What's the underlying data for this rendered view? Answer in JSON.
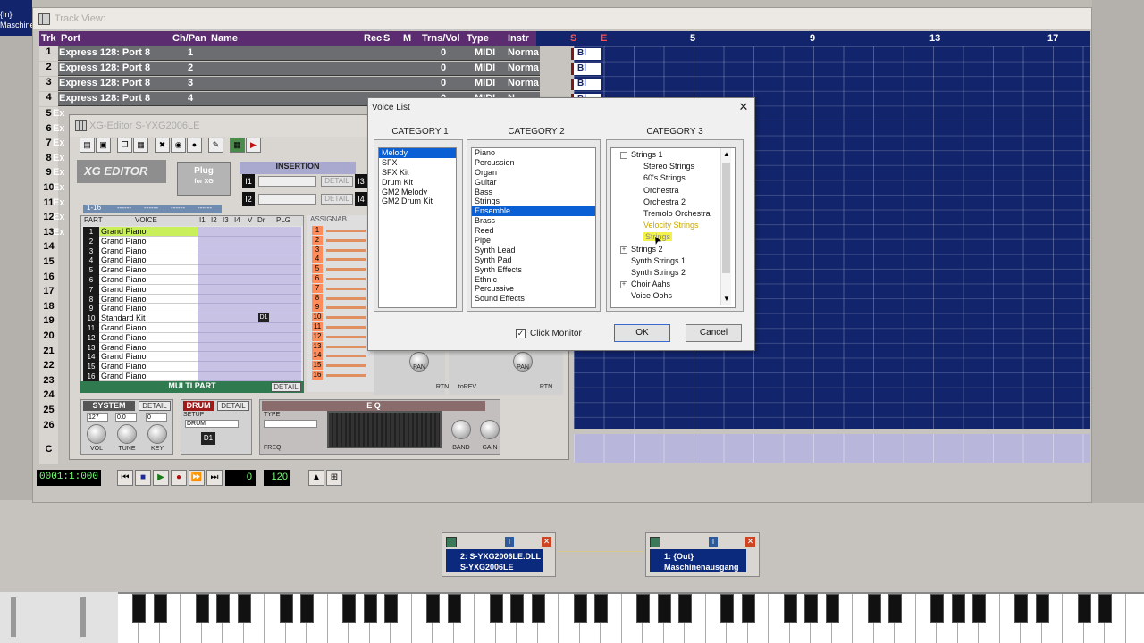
{
  "top_left": {
    "line1": "{In}",
    "line2": "Maschine"
  },
  "track_view": {
    "title": "Track View:",
    "columns": [
      "Trk",
      "Port",
      "Ch/Pan",
      "Name",
      "Rec",
      "S",
      "M",
      "Trns/Vol",
      "Type",
      "Instr"
    ],
    "rows": [
      {
        "trk": "1",
        "port": "Express  128: Port 8",
        "ch": "1",
        "trns": "0",
        "type": "MIDI",
        "instr": "Norma"
      },
      {
        "trk": "2",
        "port": "Express  128: Port 8",
        "ch": "2",
        "trns": "0",
        "type": "MIDI",
        "instr": "Norma"
      },
      {
        "trk": "3",
        "port": "Express  128: Port 8",
        "ch": "3",
        "trns": "0",
        "type": "MIDI",
        "instr": "Norma"
      },
      {
        "trk": "4",
        "port": "Express  128: Port 8",
        "ch": "4",
        "trns": "0",
        "type": "MIDI",
        "instr": "N"
      }
    ],
    "row_numbers": [
      "5",
      "6",
      "7",
      "8",
      "9",
      "10",
      "11",
      "12",
      "13",
      "14",
      "15",
      "16",
      "17",
      "18",
      "19",
      "20",
      "21",
      "22",
      "23",
      "24",
      "25",
      "26"
    ],
    "cut_prefix": "Ex",
    "ruler": {
      "markers": [
        "S",
        "E"
      ],
      "bars": [
        "5",
        "9",
        "13",
        "17"
      ]
    },
    "clips": [
      "Bl",
      "Bl",
      "Bl",
      "Bl"
    ],
    "c_row": "C"
  },
  "transport": {
    "time": "0001:1:000",
    "value": "0",
    "tempo": "120"
  },
  "xg_editor": {
    "title": "XG-Editor  S-YXG2006LE",
    "logo": "XG EDITOR",
    "plug": "Plug",
    "plug_sub": "for XG",
    "insertion_label": "INSERTION",
    "insertion_rows": [
      "I1",
      "I2"
    ],
    "insertion_right": [
      "I3",
      "I4"
    ],
    "detail": "DETAIL",
    "part_tabs": [
      "1-16",
      "------",
      "------",
      "------",
      "------"
    ],
    "multipart_headers": [
      "PART",
      "VOICE",
      "I1",
      "I2",
      "I3",
      "I4",
      "V",
      "Dr",
      "PLG"
    ],
    "assign_header": "ASSIGNAB",
    "parts": [
      {
        "n": "1",
        "voice": "Grand Piano"
      },
      {
        "n": "2",
        "voice": "Grand Piano"
      },
      {
        "n": "3",
        "voice": "Grand Piano"
      },
      {
        "n": "4",
        "voice": "Grand Piano"
      },
      {
        "n": "5",
        "voice": "Grand Piano"
      },
      {
        "n": "6",
        "voice": "Grand Piano"
      },
      {
        "n": "7",
        "voice": "Grand Piano"
      },
      {
        "n": "8",
        "voice": "Grand Piano"
      },
      {
        "n": "9",
        "voice": "Grand Piano"
      },
      {
        "n": "10",
        "voice": "Standard Kit"
      },
      {
        "n": "11",
        "voice": "Grand Piano"
      },
      {
        "n": "12",
        "voice": "Grand Piano"
      },
      {
        "n": "13",
        "voice": "Grand Piano"
      },
      {
        "n": "14",
        "voice": "Grand Piano"
      },
      {
        "n": "15",
        "voice": "Grand Piano"
      },
      {
        "n": "16",
        "voice": "Grand Piano"
      }
    ],
    "drum_marker": "D1",
    "multipart_label": "MULTI PART",
    "system": {
      "label": "SYSTEM",
      "vol": "127",
      "tune": "0.0",
      "key": "0",
      "vol_lbl": "VOL",
      "tune_lbl": "TUNE",
      "key_lbl": "KEY"
    },
    "drum": {
      "label": "DRUM",
      "setup": "SETUP",
      "value": "DRUM",
      "badge": "D1"
    },
    "eq": {
      "label": "E Q",
      "type": "TYPE",
      "freq": "FREQ",
      "band": "BAND",
      "gain": "GAIN"
    },
    "knob_labels": [
      "PAN",
      "RTN",
      "toREV",
      "PAN",
      "RTN"
    ]
  },
  "voice_list": {
    "title": "Voice List",
    "close": "✕",
    "cat1_label": "CATEGORY 1",
    "cat2_label": "CATEGORY 2",
    "cat3_label": "CATEGORY 3",
    "cat1": [
      "Melody",
      "SFX",
      "SFX Kit",
      "Drum Kit",
      "GM2 Melody",
      "GM2 Drum Kit"
    ],
    "cat1_selected": 0,
    "cat2": [
      "Piano",
      "Percussion",
      "Organ",
      "Guitar",
      "Bass",
      "Strings",
      "Ensemble",
      "Brass",
      "Reed",
      "Pipe",
      "Synth Lead",
      "Synth Pad",
      "Synth Effects",
      "Ethnic",
      "Percussive",
      "Sound Effects"
    ],
    "cat2_selected": 6,
    "cat3": [
      {
        "label": "Strings 1",
        "level": 0,
        "box": "−"
      },
      {
        "label": "Stereo Strings",
        "level": 1
      },
      {
        "label": "60's Strings",
        "level": 1
      },
      {
        "label": "Orchestra",
        "level": 1
      },
      {
        "label": "Orchestra 2",
        "level": 1
      },
      {
        "label": "Tremolo Orchestra",
        "level": 1
      },
      {
        "label": "Velocity Strings",
        "level": 1
      },
      {
        "label": "Strings",
        "level": 1
      },
      {
        "label": "Strings 2",
        "level": 0,
        "box": "+"
      },
      {
        "label": "Synth Strings 1",
        "level": 0
      },
      {
        "label": "Synth Strings 2",
        "level": 0
      },
      {
        "label": "Choir Aahs",
        "level": 0,
        "box": "+"
      },
      {
        "label": "Voice Oohs",
        "level": 0
      }
    ],
    "click_monitor": "Click Monitor",
    "ok": "OK",
    "cancel": "Cancel"
  },
  "nodes": [
    {
      "line1": "2: S-YXG2006LE.DLL",
      "line2": "S-YXG2006LE"
    },
    {
      "line1": "1: {Out}",
      "line2": "Maschinenausgang"
    }
  ],
  "colors": {
    "track_blue": "#12246b",
    "header_purple": "#5b2c6f",
    "selection": "#0a5fd4",
    "highlight": "#f2f24a"
  }
}
